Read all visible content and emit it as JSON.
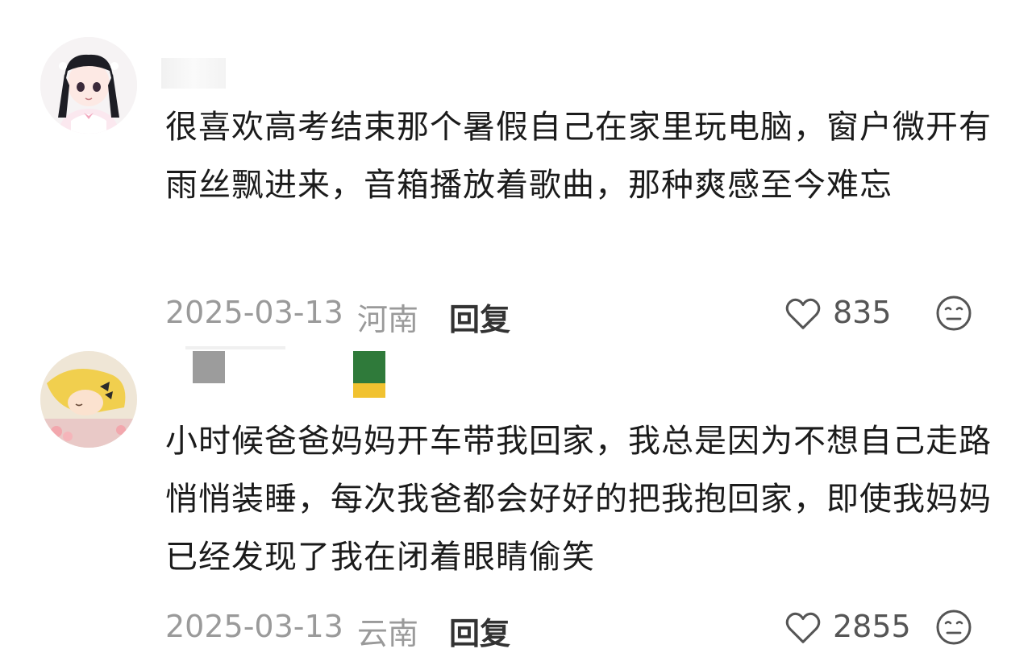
{
  "comments": [
    {
      "text": "很喜欢高考结束那个暑假自己在家里玩电脑，窗户微开有雨丝飘进来，音箱播放着歌曲，那种爽感至今难忘",
      "date": "2025-03-13",
      "location": "河南",
      "reply_label": "回复",
      "likes": "835",
      "avatar_icon": "anime-girl-avatar",
      "like_icon": "heart-outline-icon",
      "emoji_icon": "neutral-face-icon"
    },
    {
      "text": "小时候爸爸妈妈开车带我回家，我总是因为不想自己走路悄悄装睡，每次我爸都会好好的把我抱回家，即使我妈妈已经发现了我在闭着眼睛偷笑",
      "date": "2025-03-13",
      "location": "云南",
      "reply_label": "回复",
      "likes": "2855",
      "avatar_icon": "sleeping-girl-avatar",
      "like_icon": "heart-outline-icon",
      "emoji_icon": "neutral-face-icon"
    }
  ],
  "colors": {
    "text": "#1b1b1b",
    "meta": "#9a9a9a",
    "reply": "#333333"
  }
}
